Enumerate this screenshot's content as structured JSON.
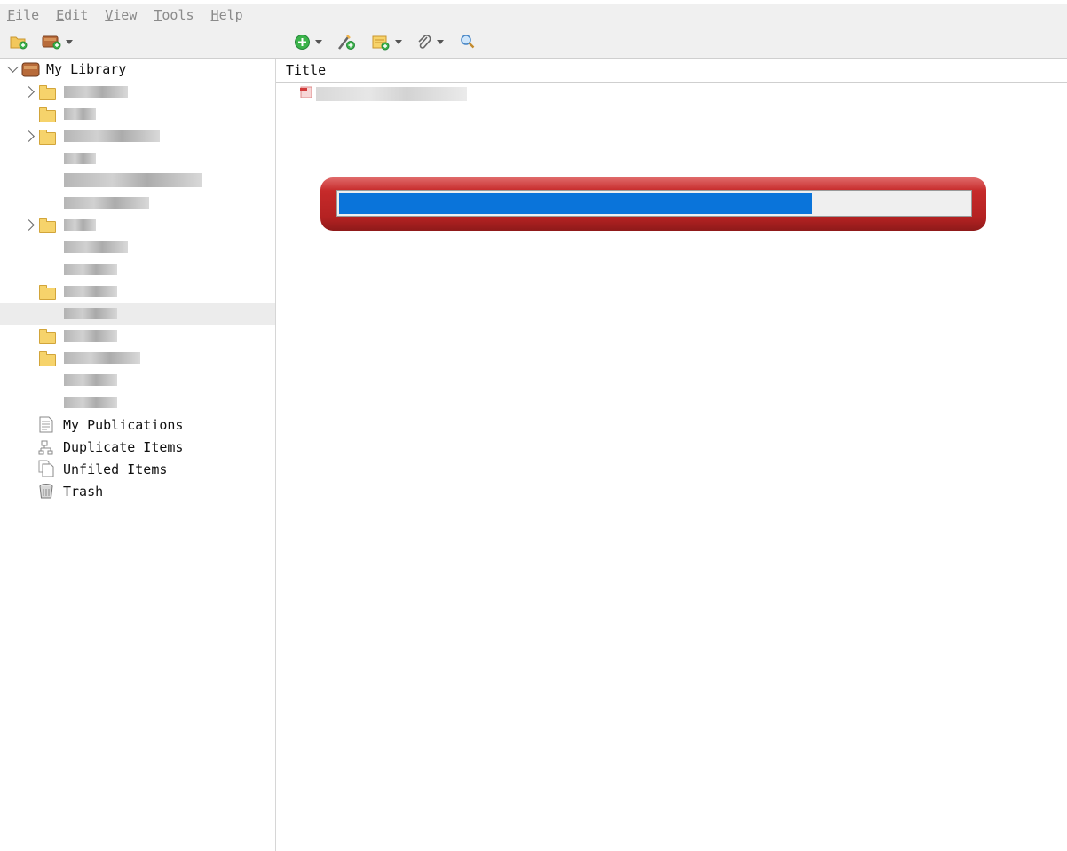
{
  "menubar": {
    "items": [
      {
        "first": "F",
        "rest": "ile"
      },
      {
        "first": "E",
        "rest": "dit"
      },
      {
        "first": "V",
        "rest": "iew"
      },
      {
        "first": "T",
        "rest": "ools"
      },
      {
        "first": "H",
        "rest": "elp"
      }
    ]
  },
  "toolbar": {
    "icons": [
      "new-collection-icon",
      "new-library-icon",
      "new-item-icon",
      "add-by-identifier-icon",
      "new-note-icon",
      "attachment-icon",
      "advanced-search-icon"
    ]
  },
  "sidebar": {
    "library_label": "My Library",
    "special_items": [
      {
        "label": "My Publications"
      },
      {
        "label": "Duplicate Items"
      },
      {
        "label": "Unfiled Items"
      },
      {
        "label": "Trash"
      }
    ]
  },
  "items_pane": {
    "column_title": "Title"
  },
  "progress": {
    "fraction": 0.75
  },
  "colors": {
    "progress_fill": "#0a74da",
    "progress_frame": "#b42222",
    "folder": "#f6d36b"
  }
}
